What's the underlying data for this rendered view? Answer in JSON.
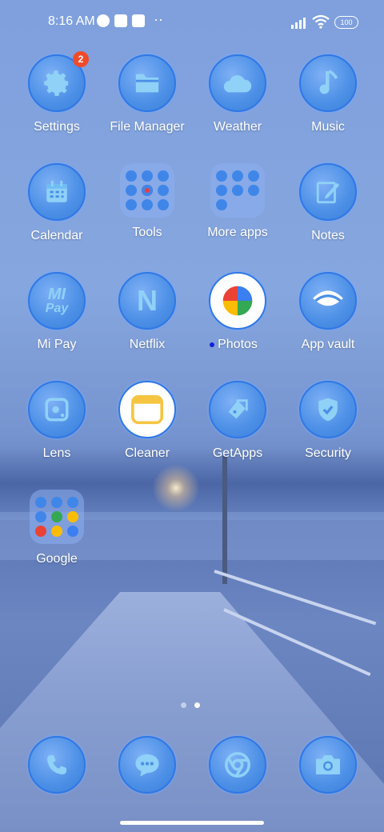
{
  "status_bar": {
    "time": "8:16 AM",
    "battery": "100"
  },
  "apps": [
    {
      "label": "Settings",
      "icon": "gear-icon",
      "badge": "2"
    },
    {
      "label": "File Manager",
      "icon": "folder-icon"
    },
    {
      "label": "Weather",
      "icon": "cloud-icon"
    },
    {
      "label": "Music",
      "icon": "music-note-icon"
    },
    {
      "label": "Calendar",
      "icon": "calendar-icon"
    },
    {
      "label": "Tools",
      "icon": "folder-tools-icon"
    },
    {
      "label": "More apps",
      "icon": "folder-more-apps-icon"
    },
    {
      "label": "Notes",
      "icon": "notes-pencil-icon"
    },
    {
      "label": "Mi Pay",
      "icon": "mi-pay-icon"
    },
    {
      "label": "Netflix",
      "icon": "netflix-n-icon"
    },
    {
      "label": "Photos",
      "icon": "photos-pinwheel-icon"
    },
    {
      "label": "App vault",
      "icon": "app-vault-icon"
    },
    {
      "label": "Lens",
      "icon": "lens-icon"
    },
    {
      "label": "Cleaner",
      "icon": "cleaner-icon"
    },
    {
      "label": "GetApps",
      "icon": "getapps-tag-icon"
    },
    {
      "label": "Security",
      "icon": "shield-check-icon"
    },
    {
      "label": "Google",
      "icon": "folder-google-icon"
    }
  ],
  "icon_glyphs": {
    "netflix": "N",
    "mi_pay_top": "MI",
    "mi_pay_bottom": "Pay"
  },
  "dock": [
    {
      "icon": "phone-icon"
    },
    {
      "icon": "messages-icon"
    },
    {
      "icon": "chrome-icon"
    },
    {
      "icon": "camera-icon"
    }
  ],
  "colors": {
    "icon_fill": "#4b8fe6",
    "icon_border": "#2f78e6",
    "badge": "#ef4b2b",
    "icon_glyph": "#8fd1f7"
  }
}
